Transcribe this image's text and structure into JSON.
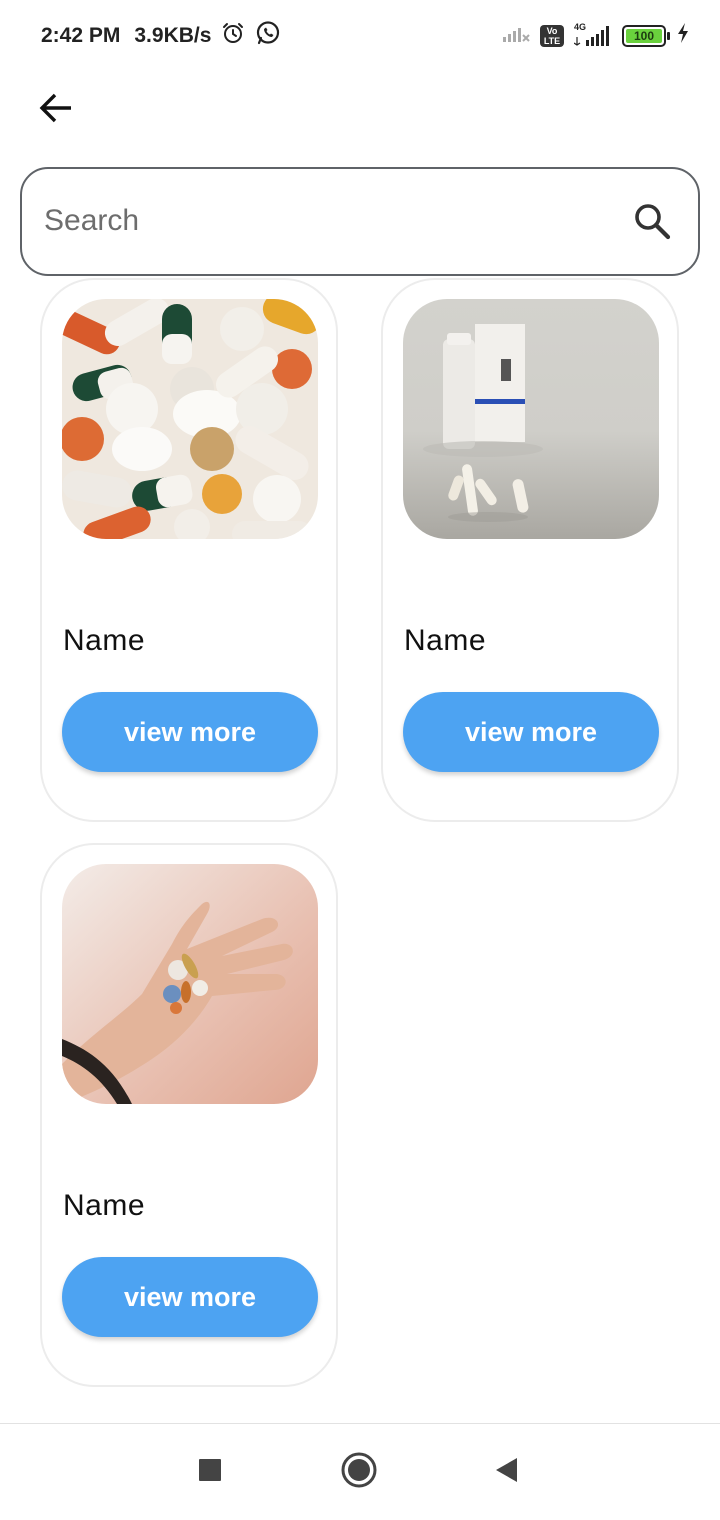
{
  "status_bar": {
    "time": "2:42 PM",
    "speed": "3.9KB/s",
    "network": "4G",
    "battery": "100",
    "icons": [
      "alarm-icon",
      "whatsapp-icon",
      "signal-muted-icon",
      "volte-icon",
      "signal-4g-icon",
      "battery-icon",
      "charging-icon"
    ],
    "volte_label": "Vo LTE"
  },
  "header": {
    "back_icon": "arrow-left-icon"
  },
  "search": {
    "placeholder": "Search",
    "value": "",
    "icon": "search-icon"
  },
  "products": [
    {
      "name": "Name",
      "button_label": "view more",
      "image": "pile of assorted pills and capsules"
    },
    {
      "name": "Name",
      "button_label": "view more",
      "image": "pill bottle and box with capsules"
    },
    {
      "name": "Name",
      "button_label": "view more",
      "image": "hand holding assorted pills"
    }
  ],
  "nav_bar": {
    "buttons": [
      "recents-square-icon",
      "home-circle-icon",
      "back-triangle-icon"
    ]
  },
  "colors": {
    "button_blue": "#4da3f2",
    "search_border": "#5f6368",
    "card_border": "#ececec",
    "battery_green": "#6ad13d"
  }
}
